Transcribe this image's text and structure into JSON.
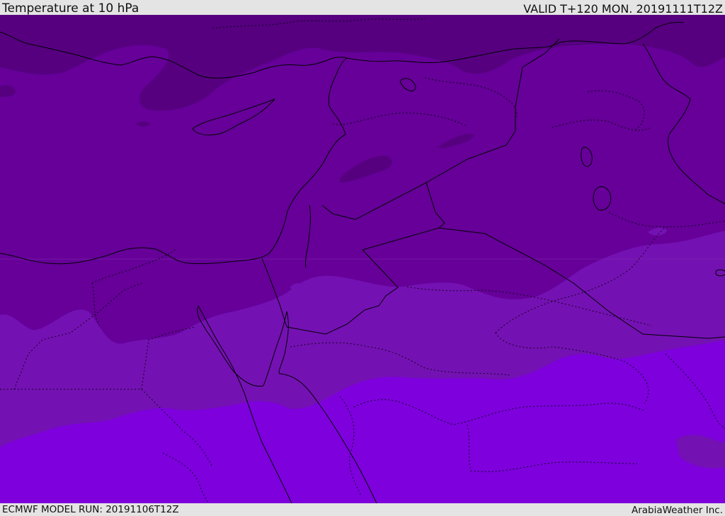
{
  "header": {
    "title": "Temperature at 10 hPa",
    "valid_text": "VALID T+120 MON. 20191111T12Z"
  },
  "footer": {
    "model_run": "ECMWF MODEL RUN: 20191106T12Z",
    "credit": "ArabiaWeather Inc."
  },
  "map": {
    "field": "temperature",
    "level": "10 hPa",
    "shading_colors": {
      "coldest": "#560080",
      "cold": "#660099",
      "mid": "#7411b3",
      "warm": "#7d00dd"
    },
    "boundary_color": "#000000"
  }
}
